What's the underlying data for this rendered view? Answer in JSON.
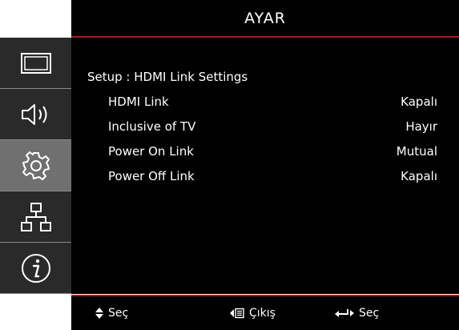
{
  "header": {
    "title": "AYAR"
  },
  "sidebar": {
    "tabs": [
      {
        "icon": "display-icon",
        "active": false
      },
      {
        "icon": "speaker-icon",
        "active": false
      },
      {
        "icon": "gear-icon",
        "active": true
      },
      {
        "icon": "network-icon",
        "active": false
      },
      {
        "icon": "info-icon",
        "active": false
      }
    ]
  },
  "main": {
    "heading": "Setup : HDMI Link Settings",
    "rows": [
      {
        "label": "HDMI Link",
        "value": "Kapalı"
      },
      {
        "label": "Inclusive of TV",
        "value": "Hayır"
      },
      {
        "label": "Power On Link",
        "value": "Mutual"
      },
      {
        "label": "Power Off Link",
        "value": "Kapalı"
      }
    ]
  },
  "footer": {
    "select_label": "Seç",
    "exit_label": "Çıkış",
    "enter_label": "Seç"
  },
  "colors": {
    "accent": "#b0161b",
    "active_tab": "#707070"
  }
}
